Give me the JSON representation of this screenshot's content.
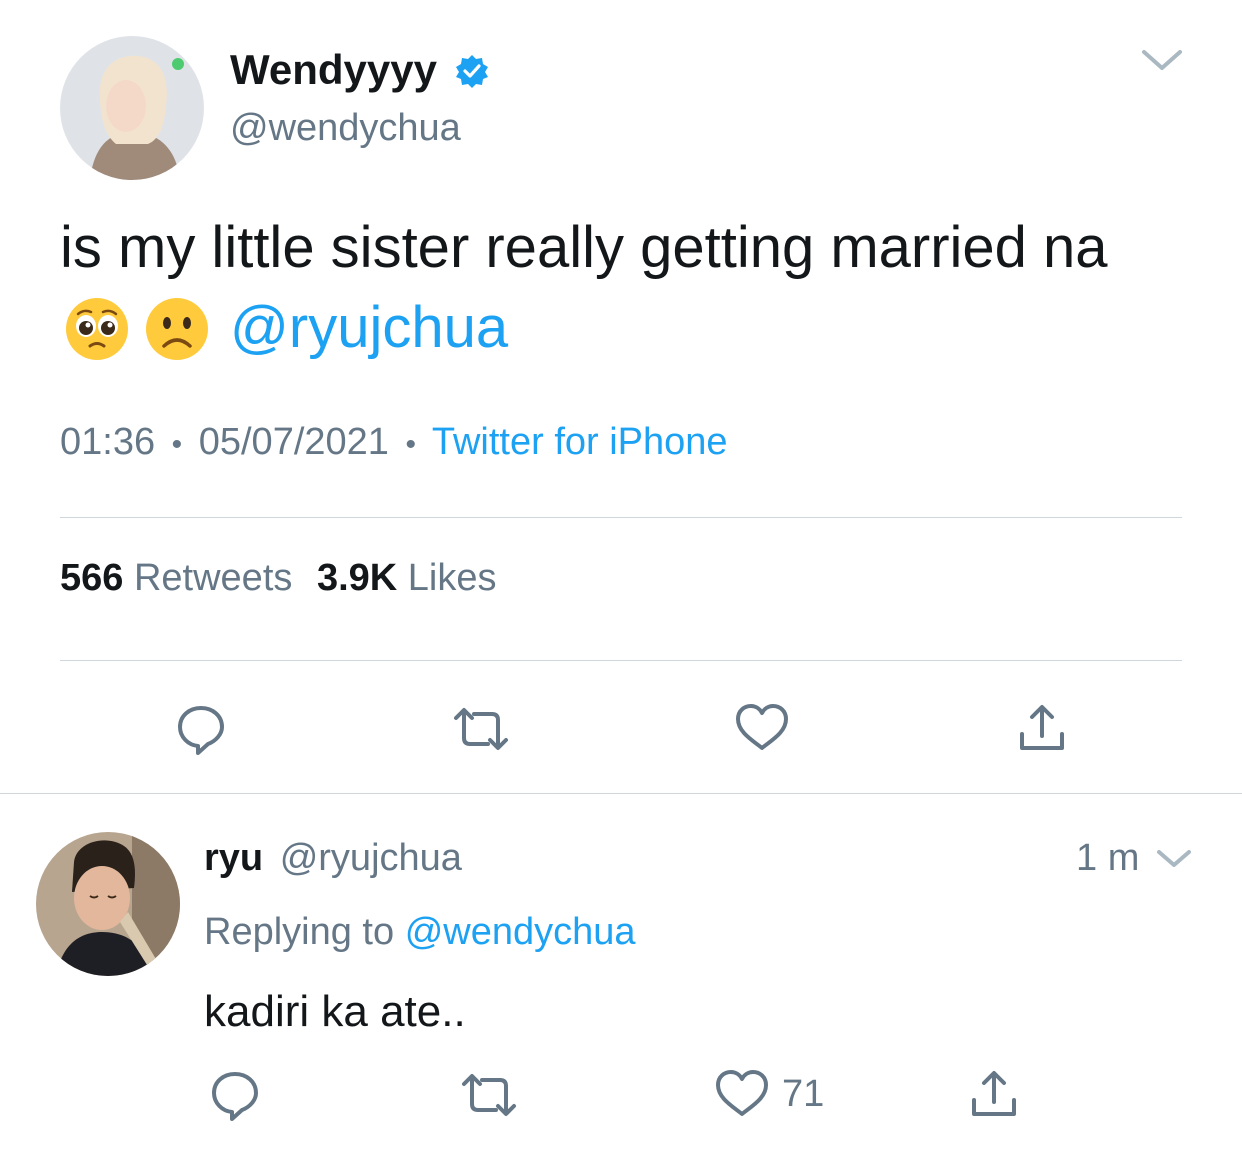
{
  "tweet": {
    "display_name": "Wendyyyy",
    "handle": "@wendychua",
    "text_line1": "is my little sister really getting married na",
    "mention": "@ryujchua",
    "time": "01:36",
    "date": "05/07/2021",
    "separator": "•",
    "source": "Twitter for iPhone",
    "retweets_count": "566",
    "retweets_label": "Retweets",
    "likes_count": "3.9K",
    "likes_label": "Likes",
    "emojis": [
      "pleading-face",
      "frowning-face"
    ]
  },
  "reply": {
    "display_name": "ryu",
    "handle": "@ryujchua",
    "time_ago": "1 m",
    "replying_label": "Replying to",
    "replying_to": "@wendychua",
    "text": "kadiri ka ate..",
    "like_count": "71"
  },
  "colors": {
    "accent": "#1da1f2",
    "secondary_text": "#657786",
    "divider": "#cfd6dc",
    "verified": "#1da1f2"
  },
  "icons": {
    "tweet_actions": [
      "reply-icon",
      "retweet-icon",
      "like-icon",
      "share-icon"
    ],
    "reply_actions": [
      "reply-icon",
      "retweet-icon",
      "like-icon",
      "share-icon"
    ],
    "verified": "verified-badge-icon",
    "menu": "chevron-down-icon"
  }
}
